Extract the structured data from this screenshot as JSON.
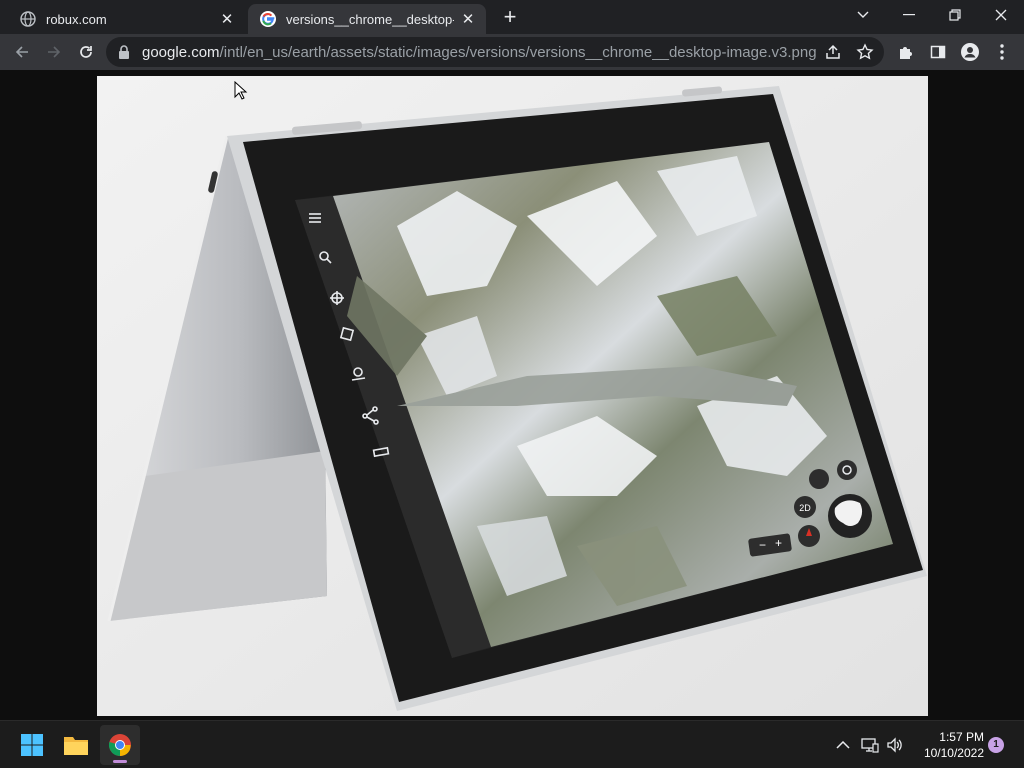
{
  "browser": {
    "tabs": [
      {
        "title": "robux.com",
        "active": false,
        "favicon": "globe-icon"
      },
      {
        "title": "versions__chrome__desktop-image",
        "active": true,
        "favicon": "google-g-icon"
      }
    ],
    "address": {
      "host": "google.com",
      "path": "/intl/en_us/earth/assets/static/images/versions/versions__chrome__desktop-image.v3.png"
    },
    "colors": {
      "frame": "#202124",
      "toolbar": "#35363a",
      "page_bg": "#0e0e0e"
    }
  },
  "image": {
    "description_icons": [
      "menu-icon",
      "search-icon",
      "voyager-icon",
      "feeling-lucky-icon",
      "projects-icon",
      "share-icon",
      "measure-icon"
    ],
    "map_controls": {
      "view_mode": "2D",
      "zoom_out": "−",
      "zoom_in": "+"
    }
  },
  "taskbar": {
    "apps": [
      "windows-start-icon",
      "file-explorer-icon",
      "chrome-icon"
    ],
    "time": "1:57 PM",
    "date": "10/10/2022",
    "notification_count": "1"
  }
}
